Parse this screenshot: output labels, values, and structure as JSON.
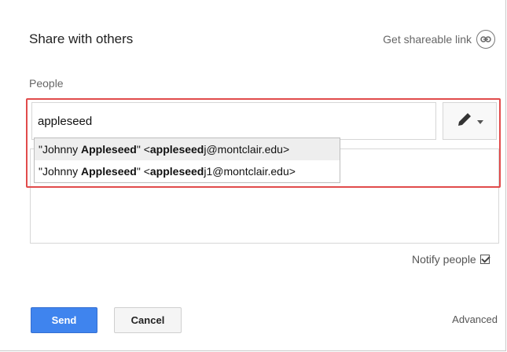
{
  "dialog": {
    "title": "Share with others",
    "shareable_link": "Get shareable link",
    "link_icon": "link-icon"
  },
  "people": {
    "label": "People",
    "input_value": "appleseed",
    "permission_icon": "pencil-icon",
    "dropdown_icon": "chevron-down-icon"
  },
  "suggestions": [
    {
      "quote_open": "\"Johnny ",
      "name_bold": "Appleseed",
      "quote_close": "\" <",
      "email_bold": "appleseed",
      "email_rest": "j@montclair.edu>",
      "selected": true
    },
    {
      "quote_open": "\"Johnny ",
      "name_bold": "Appleseed",
      "quote_close": "\" <",
      "email_bold": "appleseed",
      "email_rest": "j1@montclair.edu>",
      "selected": false
    }
  ],
  "notify": {
    "label": "Notify people",
    "checked": true
  },
  "footer": {
    "send_label": "Send",
    "cancel_label": "Cancel",
    "advanced_label": "Advanced"
  },
  "colors": {
    "send_button": "#3f84ee",
    "highlight_border": "#e14b4b"
  }
}
